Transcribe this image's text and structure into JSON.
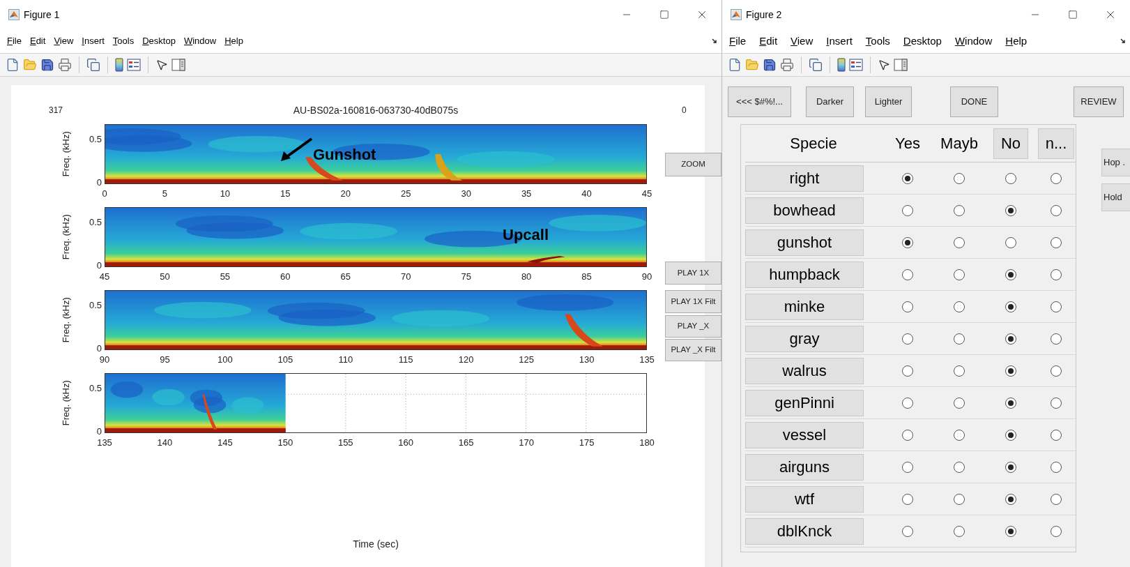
{
  "figure1": {
    "title": "Figure 1",
    "menu": [
      "File",
      "Edit",
      "View",
      "Insert",
      "Tools",
      "Desktop",
      "Window",
      "Help"
    ],
    "plot": {
      "count": "317",
      "title": "AU-BS02a-160816-063730-40dB075s",
      "corner": "0",
      "xlabel": "Time (sec)",
      "panels": [
        {
          "kind": "full",
          "ylabel": "Freq. (kHz)",
          "yticks": [
            "0.5",
            "0"
          ],
          "xticks": [
            "0",
            "5",
            "10",
            "15",
            "20",
            "25",
            "30",
            "35",
            "40",
            "45"
          ],
          "annotation": {
            "text": "Gunshot",
            "kind": "arrow"
          }
        },
        {
          "kind": "full",
          "ylabel": "Freq. (kHz)",
          "yticks": [
            "0.5",
            "0"
          ],
          "xticks": [
            "45",
            "50",
            "55",
            "60",
            "65",
            "70",
            "75",
            "80",
            "85",
            "90"
          ],
          "annotation": {
            "text": "Upcall",
            "kind": "plain"
          }
        },
        {
          "kind": "full",
          "ylabel": "Freq. (kHz)",
          "yticks": [
            "0.5",
            "0"
          ],
          "xticks": [
            "90",
            "95",
            "100",
            "105",
            "110",
            "115",
            "120",
            "125",
            "130",
            "135"
          ]
        },
        {
          "kind": "partial",
          "ylabel": "Freq. (kHz)",
          "yticks": [
            "0.5",
            "0"
          ],
          "xticks": [
            "135",
            "140",
            "145",
            "150",
            "155",
            "160",
            "165",
            "170",
            "175",
            "180"
          ]
        }
      ]
    },
    "buttons": [
      "ZOOM",
      "PLAY 1X",
      "PLAY 1X Filt",
      "PLAY _X",
      "PLAY _X Filt"
    ]
  },
  "figure2": {
    "title": "Figure 2",
    "menu": [
      "File",
      "Edit",
      "View",
      "Insert",
      "Tools",
      "Desktop",
      "Window",
      "Help"
    ],
    "buttons": [
      "<<< $#%!...",
      "Darker",
      "Lighter",
      "DONE",
      "REVIEW"
    ],
    "table": {
      "header": [
        {
          "label": "Specie",
          "kind": "text"
        },
        {
          "label": "Yes",
          "kind": "text"
        },
        {
          "label": "Mayb",
          "kind": "text"
        },
        {
          "label": "No",
          "kind": "button"
        },
        {
          "label": "n...",
          "kind": "button"
        }
      ],
      "rows": [
        {
          "label": "right",
          "options": [
            {
              "selected": true
            },
            {
              "selected": false
            },
            {
              "selected": false
            },
            {
              "selected": false
            }
          ]
        },
        {
          "label": "bowhead",
          "options": [
            {
              "selected": false
            },
            {
              "selected": false
            },
            {
              "selected": true
            },
            {
              "selected": false
            }
          ]
        },
        {
          "label": "gunshot",
          "options": [
            {
              "selected": true
            },
            {
              "selected": false
            },
            {
              "selected": false
            },
            {
              "selected": false
            }
          ]
        },
        {
          "label": "humpback",
          "options": [
            {
              "selected": false
            },
            {
              "selected": false
            },
            {
              "selected": true
            },
            {
              "selected": false
            }
          ]
        },
        {
          "label": "minke",
          "options": [
            {
              "selected": false
            },
            {
              "selected": false
            },
            {
              "selected": true
            },
            {
              "selected": false
            }
          ]
        },
        {
          "label": "gray",
          "options": [
            {
              "selected": false
            },
            {
              "selected": false
            },
            {
              "selected": true
            },
            {
              "selected": false
            }
          ]
        },
        {
          "label": "walrus",
          "options": [
            {
              "selected": false
            },
            {
              "selected": false
            },
            {
              "selected": true
            },
            {
              "selected": false
            }
          ]
        },
        {
          "label": "genPinni",
          "options": [
            {
              "selected": false
            },
            {
              "selected": false
            },
            {
              "selected": true
            },
            {
              "selected": false
            }
          ]
        },
        {
          "label": "vessel",
          "options": [
            {
              "selected": false
            },
            {
              "selected": false
            },
            {
              "selected": true
            },
            {
              "selected": false
            }
          ]
        },
        {
          "label": "airguns",
          "options": [
            {
              "selected": false
            },
            {
              "selected": false
            },
            {
              "selected": true
            },
            {
              "selected": false
            }
          ]
        },
        {
          "label": "wtf",
          "options": [
            {
              "selected": false
            },
            {
              "selected": false
            },
            {
              "selected": true
            },
            {
              "selected": false
            }
          ]
        },
        {
          "label": "dblKnck",
          "options": [
            {
              "selected": false
            },
            {
              "selected": false
            },
            {
              "selected": true
            },
            {
              "selected": false
            }
          ]
        }
      ]
    },
    "side_buttons": [
      "Hop .",
      "Hold"
    ]
  }
}
